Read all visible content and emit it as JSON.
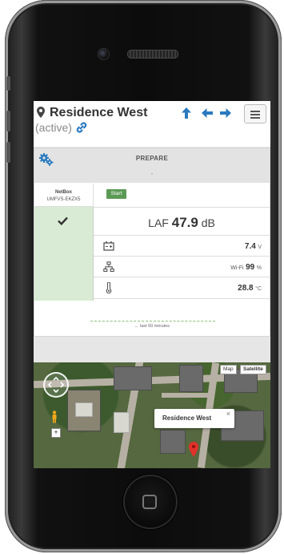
{
  "header": {
    "title": "Residence West",
    "status": "(active)"
  },
  "panel": {
    "prepare_label": "PREPARE",
    "prepare_value": "-",
    "device_name": "NetBox",
    "device_id": "UMFVS-EKZX5",
    "start_label": "Start"
  },
  "measurements": {
    "laf_label": "LAF",
    "laf_value": "47.9",
    "laf_unit": "dB",
    "battery_value": "7.4",
    "battery_unit": "V",
    "network_label": "Wi-Fi",
    "network_value": "99",
    "network_unit": "%",
    "temperature_value": "28.8",
    "temperature_unit": "°C"
  },
  "trend_label": "← last 60 minutes",
  "map": {
    "map_button": "Map",
    "satellite_button": "Satellite",
    "info_title": "Residence West",
    "info_close": "×",
    "zoom_in": "+"
  },
  "colors": {
    "accent_blue": "#2a7ac0",
    "start_green": "#5b9a55",
    "status_green_bg": "#d9ebd4",
    "marker_red": "#e0312a"
  },
  "icons": {
    "location": "map-pin-icon",
    "link": "link-icon",
    "up": "arrow-up-icon",
    "left": "arrow-left-icon",
    "right": "arrow-right-icon",
    "menu": "hamburger-menu-icon",
    "settings": "gears-icon",
    "check": "checkmark-icon",
    "battery": "battery-icon",
    "network": "network-icon",
    "temperature": "thermometer-icon"
  }
}
